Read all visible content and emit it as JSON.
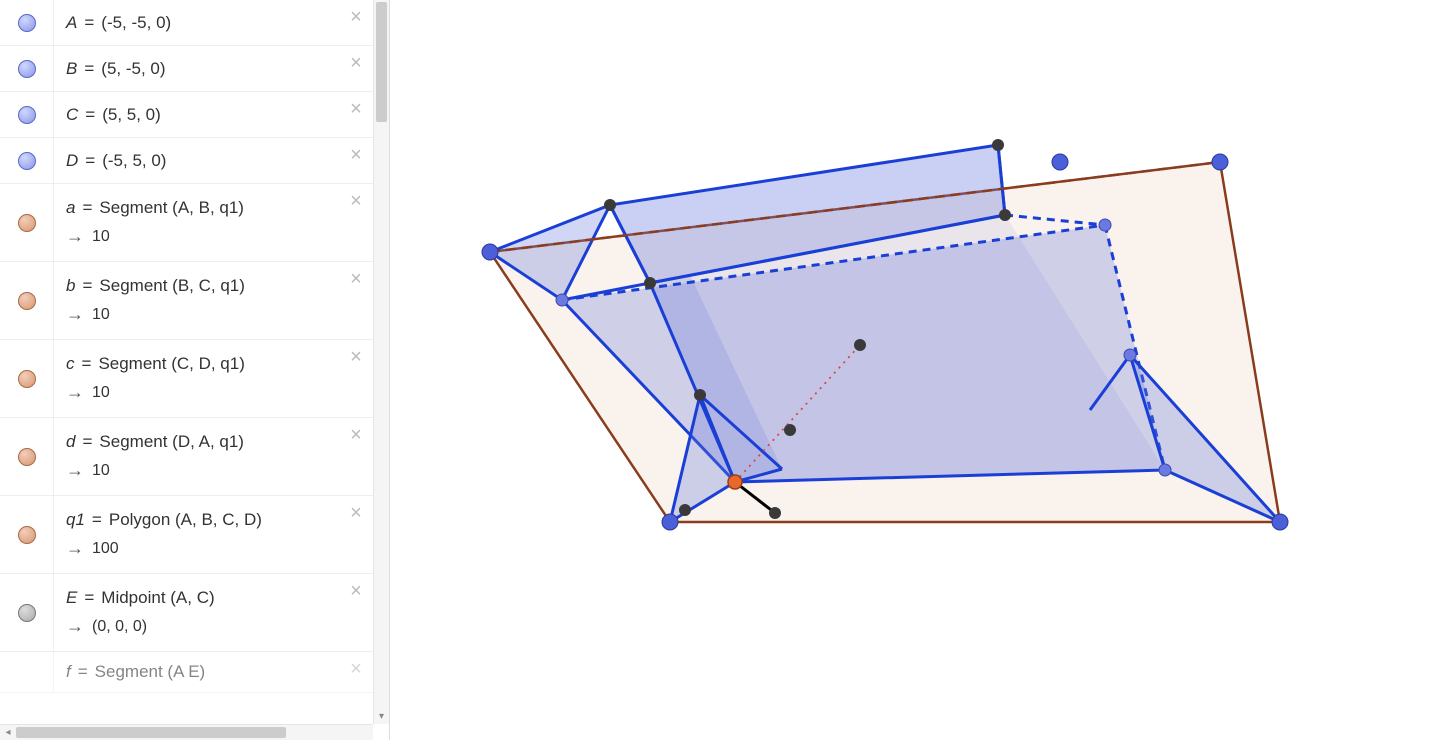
{
  "algebra": [
    {
      "bullet": "blue",
      "name": "A",
      "expr": "(-5, -5, 0)",
      "result": null
    },
    {
      "bullet": "blue",
      "name": "B",
      "expr": "(5, -5, 0)",
      "result": null
    },
    {
      "bullet": "blue",
      "name": "C",
      "expr": "(5, 5, 0)",
      "result": null
    },
    {
      "bullet": "blue",
      "name": "D",
      "expr": "(-5, 5, 0)",
      "result": null
    },
    {
      "bullet": "brown",
      "name": "a",
      "expr": "Segment (A, B, q1)",
      "result": "10"
    },
    {
      "bullet": "brown",
      "name": "b",
      "expr": "Segment (B, C, q1)",
      "result": "10"
    },
    {
      "bullet": "brown",
      "name": "c",
      "expr": "Segment (C, D, q1)",
      "result": "10"
    },
    {
      "bullet": "brown",
      "name": "d",
      "expr": "Segment (D, A, q1)",
      "result": "10"
    },
    {
      "bullet": "brown",
      "name": "q1",
      "expr": "Polygon (A, B, C, D)",
      "result": "100"
    },
    {
      "bullet": "gray",
      "name": "E",
      "expr": "Midpoint (A, C)",
      "result": "(0, 0, 0)"
    }
  ],
  "partial_row": {
    "name": "f",
    "expr": "Segment (A  E)"
  },
  "colors": {
    "blue_stroke": "#1a3fd6",
    "blue_fill": "rgba(100,120,220,0.2)",
    "brown_stroke": "#8a3d1e",
    "brown_fill": "rgba(210,150,110,0.15)",
    "point_blue": "#4a5fd8",
    "point_dark": "#3a3a3a",
    "point_orange": "#e66a2e",
    "dotted_red": "#d44"
  }
}
